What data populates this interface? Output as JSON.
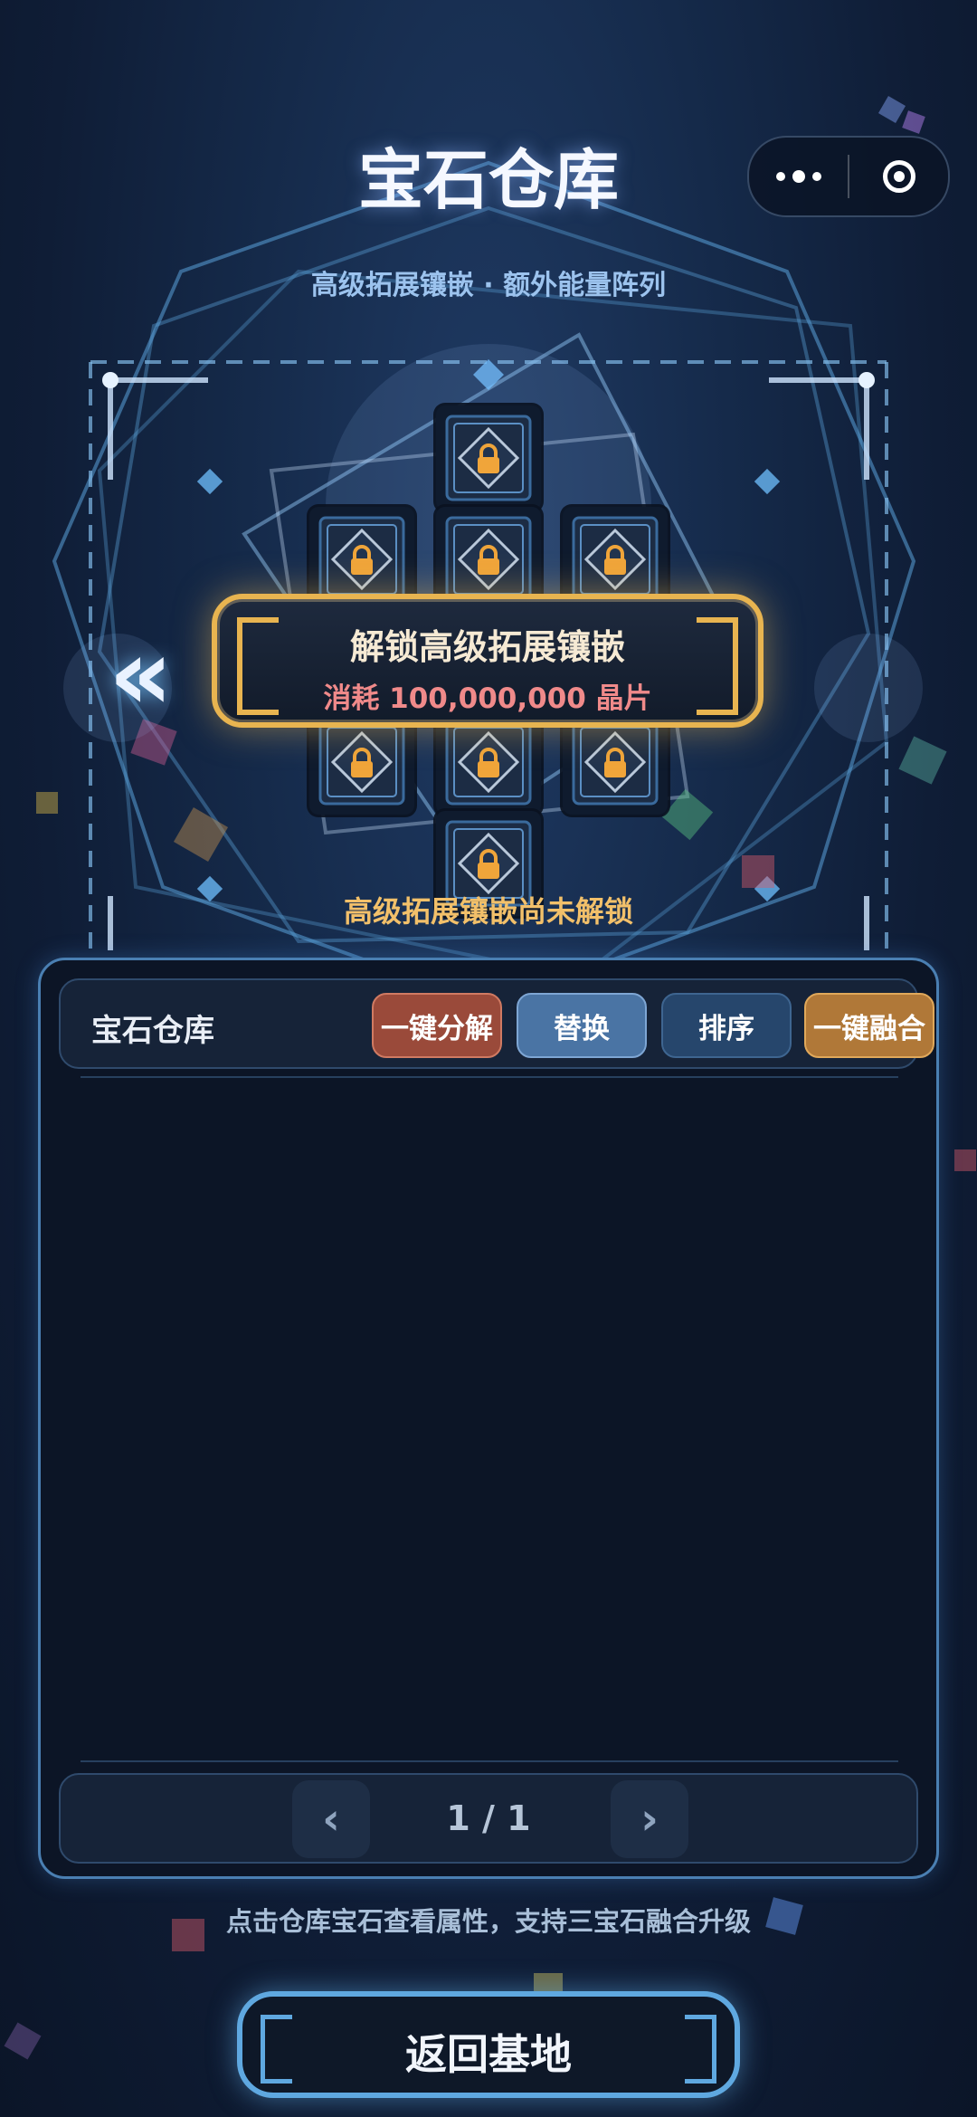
{
  "header": {
    "title": "宝石仓库",
    "subtitle": "高级拓展镶嵌 · 额外能量阵列"
  },
  "capsule": {
    "more_icon": "more-dots-icon",
    "close_icon": "target-circle-icon"
  },
  "socket_grid": {
    "slot_icon": "lock-icon",
    "slot_count": 9,
    "prev_icon": "double-chevron-left-icon"
  },
  "unlock_button": {
    "label": "解锁高级拓展镶嵌",
    "cost": "消耗 100,000,000 晶片"
  },
  "locked_note": "高级拓展镶嵌尚未解锁",
  "warehouse": {
    "title": "宝石仓库",
    "buttons": {
      "decompose": "一键分解",
      "replace": "替换",
      "sort": "排序",
      "fuse": "一键融合"
    },
    "pager": {
      "prev": "‹",
      "page": "1 / 1",
      "next": "›"
    }
  },
  "hint": "点击仓库宝石查看属性，支持三宝石融合升级",
  "back_button": {
    "label": "返回基地"
  },
  "colors": {
    "accent_gold": "#e8b450",
    "accent_blue": "#5fa8e0",
    "cost_red": "#f08a8a",
    "decompose": "#9a4a3a",
    "replace": "#4a74a4",
    "sort": "#26466c",
    "fuse": "#b07838"
  }
}
